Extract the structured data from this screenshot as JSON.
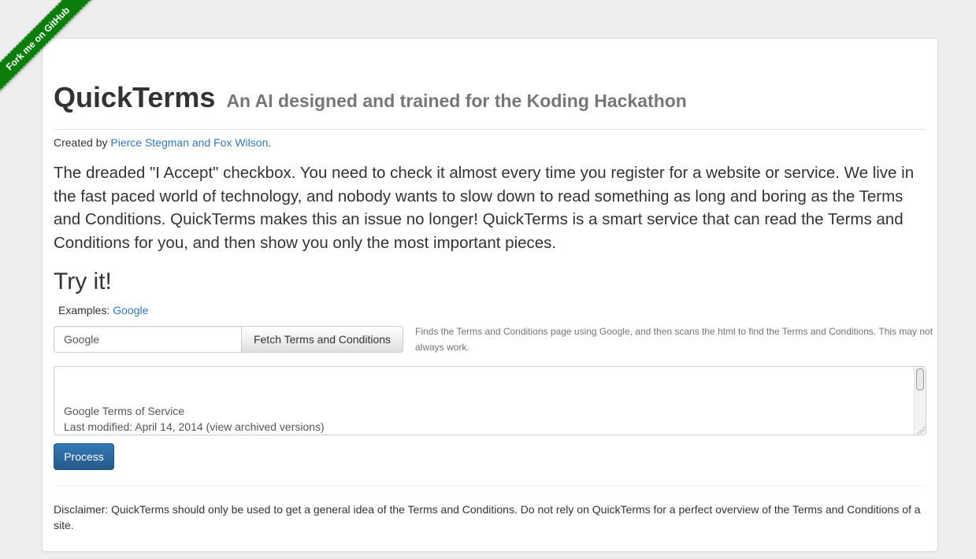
{
  "ribbon": {
    "label": "Fork me on GitHub",
    "color": "#0a7d0a"
  },
  "header": {
    "title": "QuickTerms",
    "subtitle": "An AI designed and trained for the Koding Hackathon"
  },
  "credits": {
    "prefix": "Created by ",
    "authors": "Pierce Stegman and Fox Wilson",
    "suffix": "."
  },
  "intro": "The dreaded \"I Accept\" checkbox. You need to check it almost every time you register for a website or service. We live in the fast paced world of technology, and nobody wants to slow down to read something as long and boring as the Terms and Conditions. QuickTerms makes this an issue no longer! QuickTerms is a smart service that can read the Terms and Conditions for you, and then show you only the most important pieces.",
  "try_section": {
    "heading": "Try it!",
    "examples_label": "Examples: ",
    "example_link": "Google"
  },
  "fetch_form": {
    "input_value": "Google",
    "button_label": "Fetch Terms and Conditions",
    "help_text": "Finds the Terms and Conditions page using Google, and then scans the html to find the Terms and Conditions. This may not always work."
  },
  "terms_textarea": {
    "line1": "Google Terms of Service",
    "line2": "Last modified: April 14, 2014 (view archived versions)"
  },
  "process_button": {
    "label": "Process",
    "color": "#337ab7"
  },
  "disclaimer": "Disclaimer: QuickTerms should only be used to get a general idea of the Terms and Conditions. Do not rely on QuickTerms for a perfect overview of the Terms and Conditions of a site."
}
